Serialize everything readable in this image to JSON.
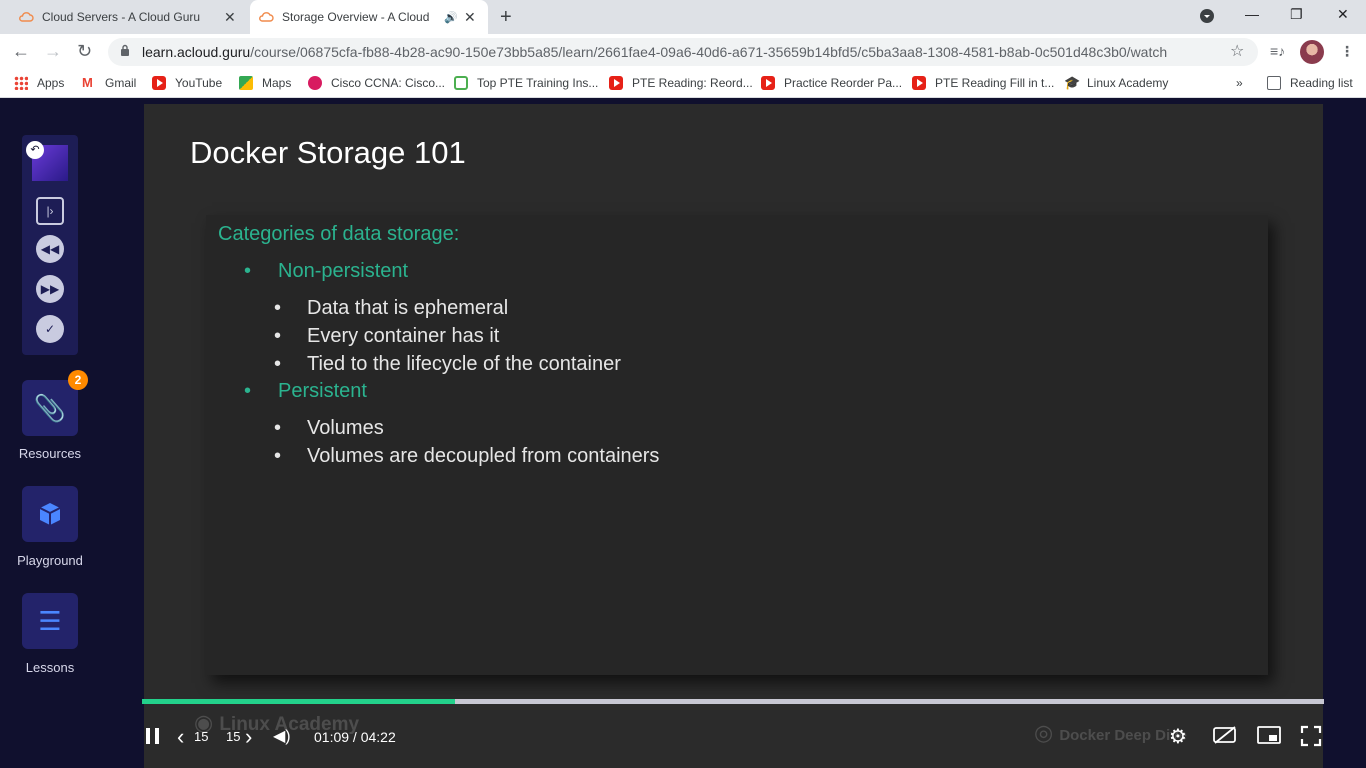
{
  "browser": {
    "tabs": [
      {
        "title": "Cloud Servers - A Cloud Guru",
        "active": false
      },
      {
        "title": "Storage Overview - A Cloud",
        "active": true
      }
    ],
    "url_host": "learn.acloud.guru",
    "url_path": "/course/06875cfa-fb88-4b28-ac90-150e73bb5a85/learn/2661fae4-09a6-40d6-a671-35659b14bfd5/c5ba3aa8-1308-4581-b8ab-0c501d48c3b0/watch",
    "bookmarks": [
      {
        "label": "Apps",
        "icon": "apps-grid-icon"
      },
      {
        "label": "Gmail",
        "icon": "gmail-icon"
      },
      {
        "label": "YouTube",
        "icon": "youtube-icon"
      },
      {
        "label": "Maps",
        "icon": "maps-icon"
      },
      {
        "label": "Cisco CCNA: Cisco...",
        "icon": "cisco-icon"
      },
      {
        "label": "Top PTE Training Ins...",
        "icon": "shield-icon"
      },
      {
        "label": "PTE Reading: Reord...",
        "icon": "youtube-icon"
      },
      {
        "label": "Practice Reorder Pa...",
        "icon": "youtube-icon"
      },
      {
        "label": "PTE Reading Fill in t...",
        "icon": "youtube-icon"
      },
      {
        "label": "Linux Academy",
        "icon": "graduation-cap-icon"
      }
    ],
    "reading_list": "Reading list",
    "overflow": "»"
  },
  "sidebar": {
    "resources_label": "Resources",
    "resources_badge": "2",
    "playground_label": "Playground",
    "lessons_label": "Lessons"
  },
  "slide": {
    "title": "Docker Storage 101",
    "category_heading": "Categories of data storage:",
    "bullet": "•",
    "non_persistent": "Non-persistent",
    "non_persistent_items": [
      "Data that is ephemeral",
      "Every container has it",
      "Tied to the lifecycle of the container"
    ],
    "persistent": "Persistent",
    "persistent_items": [
      "Volumes",
      "Volumes are decoupled from containers"
    ]
  },
  "watermarks": {
    "left": "Linux Academy",
    "right": "Docker Deep Dive"
  },
  "player": {
    "skip_back": "15",
    "skip_forward": "15",
    "time": "01:09 / 04:22",
    "progress_fraction": 0.265
  },
  "colors": {
    "accent_green": "#2bb38f",
    "progress": "#23d18b",
    "badge": "#ff8a00"
  }
}
